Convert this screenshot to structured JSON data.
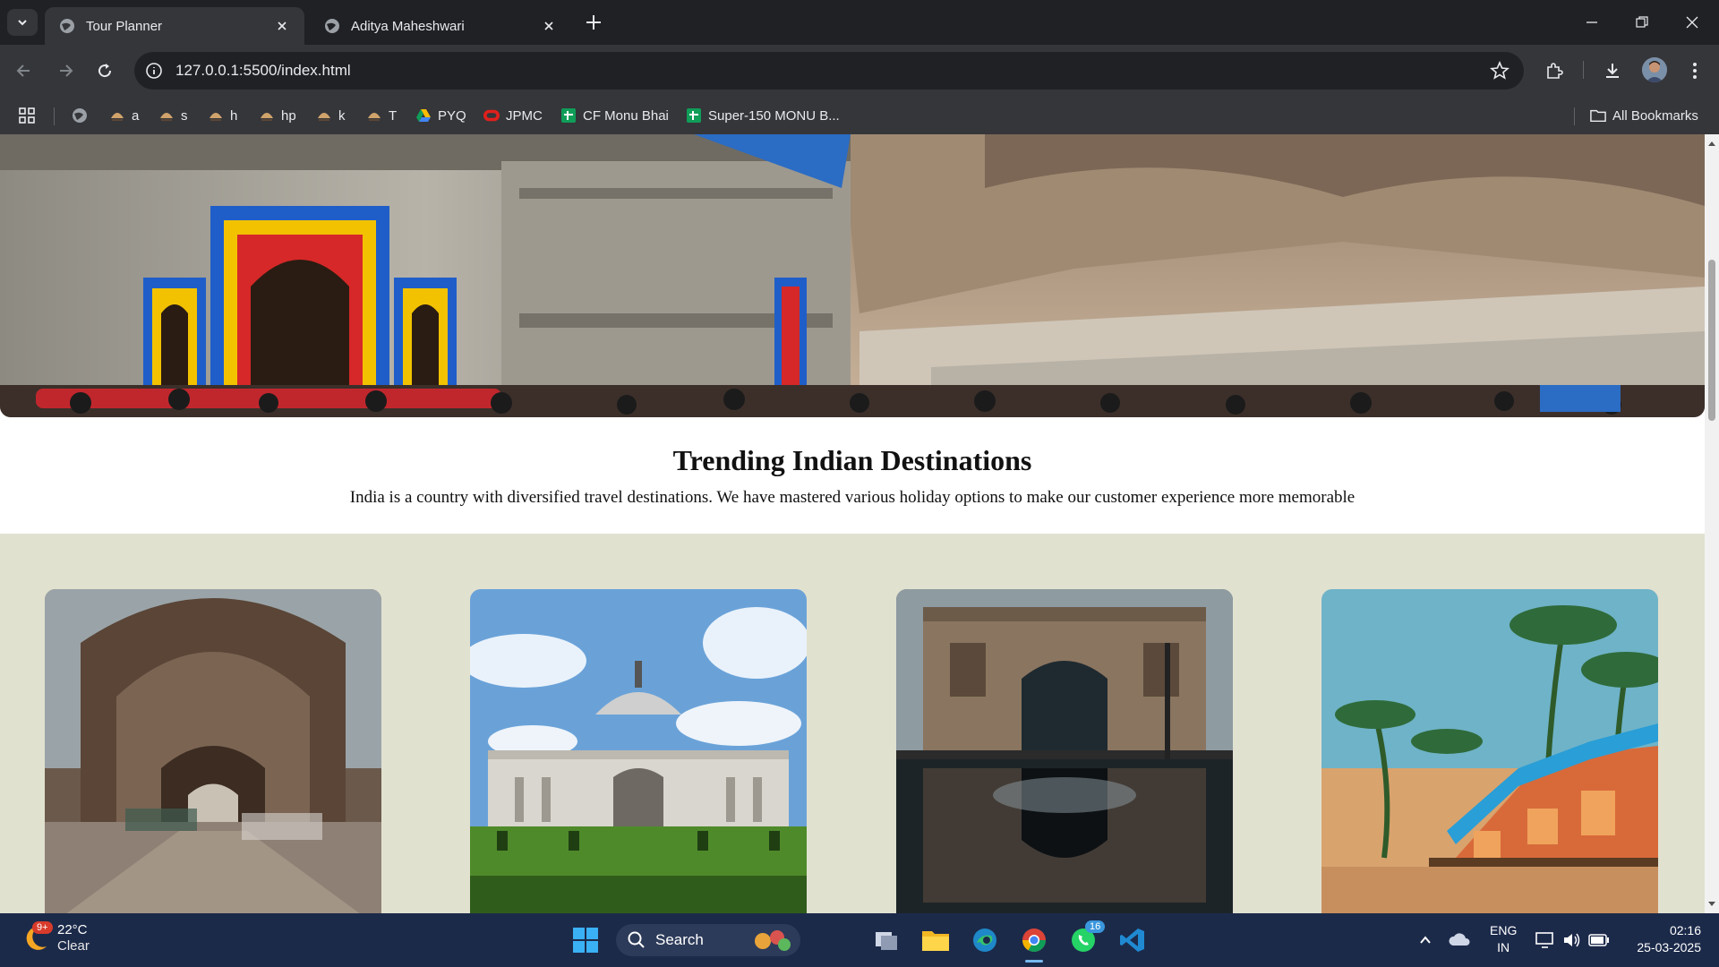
{
  "browser": {
    "tabs": [
      {
        "title": "Tour Planner",
        "active": true
      },
      {
        "title": "Aditya Maheshwari",
        "active": false
      }
    ],
    "url": "127.0.0.1:5500/index.html",
    "bookmarks": [
      {
        "label": "",
        "icon": "globe-icon"
      },
      {
        "label": "a",
        "icon": "codechef-icon"
      },
      {
        "label": "s",
        "icon": "codechef-icon"
      },
      {
        "label": "h",
        "icon": "codechef-icon"
      },
      {
        "label": "hp",
        "icon": "codechef-icon"
      },
      {
        "label": "k",
        "icon": "codechef-icon"
      },
      {
        "label": "T",
        "icon": "codechef-icon"
      },
      {
        "label": "PYQ",
        "icon": "google-drive-icon"
      },
      {
        "label": "JPMC",
        "icon": "oracle-icon"
      },
      {
        "label": "CF Monu Bhai",
        "icon": "sheets-icon"
      },
      {
        "label": "Super-150 MONU B...",
        "icon": "sheets-icon"
      }
    ],
    "all_bookmarks_label": "All Bookmarks"
  },
  "page": {
    "heading": "Trending Indian Destinations",
    "subheading": "India is a country with diversified travel destinations. We have mastered various holiday options to make our customer experience more memorable",
    "hero_image": "temple-photo",
    "cards": [
      {
        "image": "rumi-darwaza-photo"
      },
      {
        "image": "victoria-memorial-photo"
      },
      {
        "image": "gateway-of-india-photo"
      },
      {
        "image": "beach-huts-photo"
      }
    ],
    "colors": {
      "section_bg": "#e1e1d0",
      "page_bg": "#ffffff"
    }
  },
  "taskbar": {
    "weather_temp": "22°C",
    "weather_cond": "Clear",
    "weather_badge": "9+",
    "search_label": "Search",
    "whatsapp_badge": "16",
    "lang_top": "ENG",
    "lang_bottom": "IN",
    "time": "02:16",
    "date": "25-03-2025"
  }
}
